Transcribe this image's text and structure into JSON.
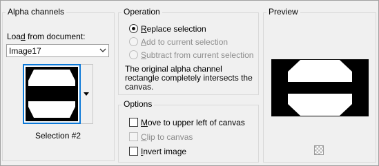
{
  "alpha_channels": {
    "title": "Alpha channels",
    "load_from_label": "Load from document:",
    "load_from_ul": "d",
    "document_value": "Image17",
    "selection_name": "Selection #2"
  },
  "operation": {
    "title": "Operation",
    "options": [
      {
        "label": "Replace selection",
        "ul": "R",
        "selected": true,
        "enabled": true
      },
      {
        "label": "Add to current selection",
        "ul": "A",
        "selected": false,
        "enabled": false
      },
      {
        "label": "Subtract from current selection",
        "ul": "S",
        "selected": false,
        "enabled": false
      }
    ],
    "description": "The original alpha channel rectangle completely intersects the canvas."
  },
  "options": {
    "title": "Options",
    "items": [
      {
        "label": "Move to upper left of canvas",
        "ul": "M",
        "checked": false,
        "enabled": true
      },
      {
        "label": "Clip to canvas",
        "ul": "C",
        "checked": false,
        "enabled": false
      },
      {
        "label": "Invert image",
        "ul": "I",
        "checked": false,
        "enabled": true
      }
    ]
  },
  "preview": {
    "title": "Preview",
    "background_icon": "checkerboard-icon"
  },
  "colors": {
    "accent": "#0b78d7",
    "window_bg": "#f0f0f0",
    "disabled_text": "#8d8d8d"
  }
}
